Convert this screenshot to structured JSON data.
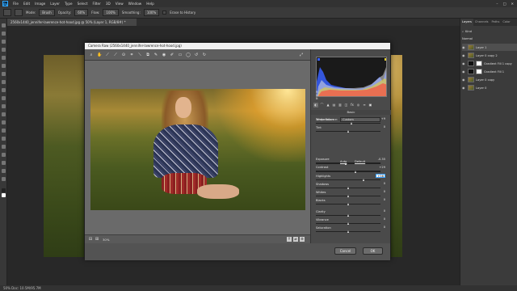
{
  "app": {
    "logo": "Ps"
  },
  "menu": [
    "File",
    "Edit",
    "Image",
    "Layer",
    "Type",
    "Select",
    "Filter",
    "3D",
    "View",
    "Window",
    "Help"
  ],
  "options_bar": {
    "mode_label": "Mode:",
    "mode_value": "Brush",
    "opacity_label": "Opacity:",
    "opacity_value": "60%",
    "flow_label": "Flow:",
    "flow_value": "100%",
    "smoothing_label": "Smoothing:",
    "smoothing_value": "100%",
    "erase_to_history": "Erase to History"
  },
  "document_tab": "2560x1440_jennifer-lawrence-hot-hood.jpg @ 50% (Layer 1, RGB/8#) *",
  "status_bar": "50%   Doc: 10.5M/95.7M",
  "layers_panel": {
    "tabs": [
      "Layers",
      "Channels",
      "Paths",
      "Color"
    ],
    "kind_label": "Kind",
    "blend_mode": "Normal",
    "layers": [
      {
        "name": "Layer 1",
        "thumb": "photo",
        "selected": true
      },
      {
        "name": "Layer 0 copy 2",
        "thumb": "photo",
        "selected": false
      },
      {
        "name": "Gradient Fill 1 copy",
        "thumb": "mask",
        "selected": false
      },
      {
        "name": "Gradient Fill 1",
        "thumb": "mask",
        "selected": false
      },
      {
        "name": "Layer 0 copy",
        "thumb": "photo",
        "selected": false
      },
      {
        "name": "Layer 0",
        "thumb": "photo",
        "selected": false
      }
    ]
  },
  "camera_raw": {
    "title": "Camera Raw (2560x1440_jennifer-lawrence-hot-hood.jpg)",
    "zoom_value": "30%",
    "basic_title": "Basic",
    "white_balance_label": "White Balance:",
    "white_balance_value": "Custom",
    "auto_link": "Auto",
    "default_link": "Default",
    "histogram_info": {
      "r": "R:",
      "g": "G:",
      "b": "B:"
    },
    "sliders": [
      {
        "name": "Temperature",
        "value": "+9",
        "pos": 0.56,
        "track": "temp"
      },
      {
        "name": "Tint",
        "value": "0",
        "pos": 0.5,
        "track": "tint"
      },
      {
        "name": "Exposure",
        "value": "-0.35",
        "pos": 0.47,
        "track": "plain"
      },
      {
        "name": "Contrast",
        "value": "+29",
        "pos": 0.62,
        "track": "plain"
      },
      {
        "name": "Highlights",
        "value": "+58",
        "pos": 0.74,
        "track": "plain",
        "highlight": true
      },
      {
        "name": "Shadows",
        "value": "0",
        "pos": 0.5,
        "track": "plain"
      },
      {
        "name": "Whites",
        "value": "0",
        "pos": 0.5,
        "track": "plain"
      },
      {
        "name": "Blacks",
        "value": "0",
        "pos": 0.5,
        "track": "plain"
      },
      {
        "name": "Clarity",
        "value": "0",
        "pos": 0.5,
        "track": "plain"
      },
      {
        "name": "Vibrance",
        "value": "0",
        "pos": 0.5,
        "track": "vib"
      },
      {
        "name": "Saturation",
        "value": "0",
        "pos": 0.5,
        "track": "sat"
      }
    ],
    "cancel_label": "Cancel",
    "ok_label": "OK"
  }
}
